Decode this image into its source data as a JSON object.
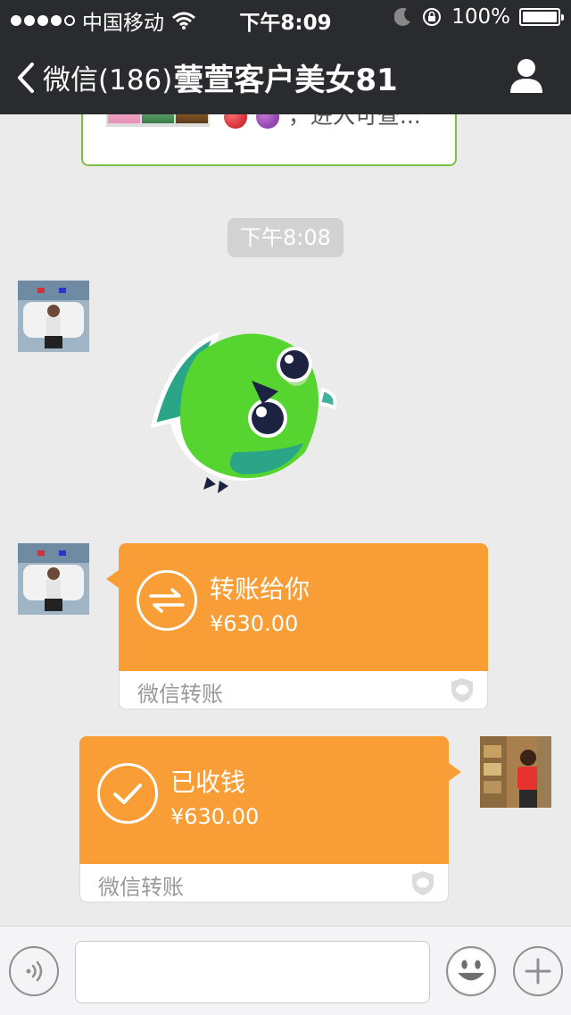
{
  "status_bar": {
    "carrier": "中国移动",
    "time": "下午8:09",
    "battery": "100%"
  },
  "nav": {
    "back_label": "微信(186)",
    "title": "蕓萱客户美女81"
  },
  "messages": {
    "link_card": {
      "description": "，进入可查..."
    },
    "timestamp": "下午8:08",
    "transfer_in": {
      "title": "转账给你",
      "amount": "¥630.00",
      "footer": "微信转账"
    },
    "transfer_out": {
      "title": "已收钱",
      "amount": "¥630.00",
      "footer": "微信转账"
    }
  },
  "colors": {
    "nav_bg": "#2a2b2e",
    "chat_bg": "#ebebeb",
    "transfer_orange": "#f99e37",
    "link_border": "#7ac143"
  },
  "icons": {
    "back": "chevron-left-icon",
    "profile": "person-icon",
    "voice": "voice-icon",
    "emoji": "smiley-icon",
    "add": "plus-icon",
    "transfer": "exchange-arrows-icon",
    "received": "checkmark-icon",
    "shield": "shield-icon"
  }
}
